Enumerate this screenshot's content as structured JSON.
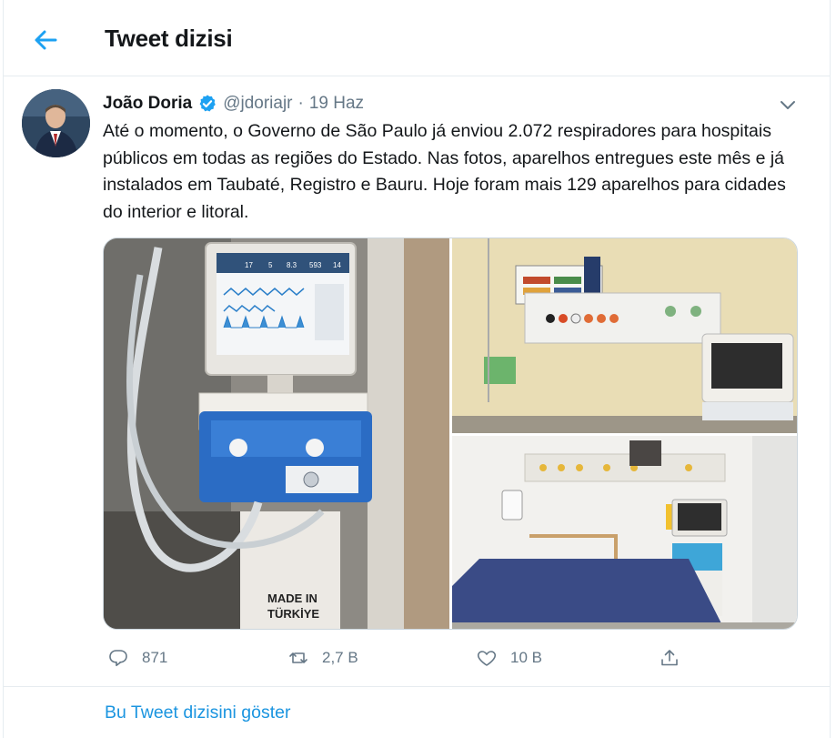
{
  "header": {
    "title": "Tweet dizisi",
    "back_icon": "arrow-left-icon"
  },
  "tweet": {
    "author_name": "João Doria",
    "verified": true,
    "handle": "@jdoriajr",
    "separator": "·",
    "date": "19 Haz",
    "text": "Até o momento, o Governo de São Paulo já enviou 2.072 respiradores para hospitais públicos em todas as regiões do Estado. Nas fotos, aparelhos entregues este mês e já instalados em Taubaté, Registro e Bauru. Hoje foram mais 129 aparelhos para cidades do interior e litoral.",
    "photos": [
      {
        "label": "ventilator-photo",
        "monitor_values": [
          "17",
          "5",
          "8.3",
          "593",
          "14"
        ],
        "stamp": "MADE IN\nTÜRKİYE"
      },
      {
        "label": "hospital-wall-photo"
      },
      {
        "label": "hospital-bed-photo"
      }
    ],
    "actions": {
      "reply_count": "871",
      "retweet_count": "2,7 B",
      "like_count": "10 B"
    }
  },
  "footer": {
    "show_thread_label": "Bu Tweet dizisini göster"
  },
  "colors": {
    "accent": "#1da1f2",
    "link": "#1b95e0",
    "muted": "#657786",
    "border": "#e6ecf0"
  }
}
